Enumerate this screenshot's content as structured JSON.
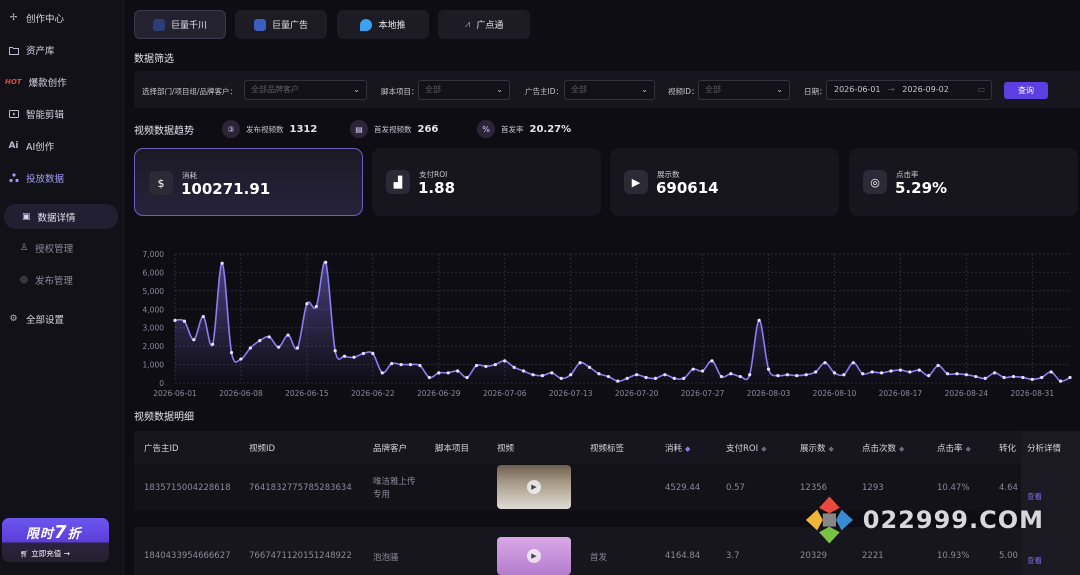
{
  "sidebar": {
    "items": [
      {
        "label": "创作中心",
        "icon": "cross-arrows-icon"
      },
      {
        "label": "资产库",
        "icon": "folder-icon"
      },
      {
        "label": "爆款创作",
        "icon": "hot-icon",
        "badge": "HOT"
      },
      {
        "label": "智能剪辑",
        "icon": "video-edit-icon"
      },
      {
        "label": "AI创作",
        "icon": "ai-icon",
        "badge": "Ai"
      },
      {
        "label": "投放数据",
        "icon": "nodes-icon"
      }
    ],
    "sub_items": [
      {
        "label": "数据详情",
        "icon": "chart-icon"
      },
      {
        "label": "授权管理",
        "icon": "user-icon"
      },
      {
        "label": "发布管理",
        "icon": "publish-icon"
      }
    ],
    "settings_label": "全部设置",
    "promo": {
      "title_a": "限时",
      "title_num": "7",
      "title_b": "折",
      "cta": "立即充值 →"
    }
  },
  "tabs": [
    {
      "label": "巨量千川",
      "icon_color": "#5b8cf5"
    },
    {
      "label": "巨量广告",
      "icon_color": "#4a7ff0"
    },
    {
      "label": "本地推",
      "icon_color": "#3ea0f0"
    },
    {
      "label": "广点通",
      "icon_color": "#5a6cf0"
    }
  ],
  "filters": {
    "section_title": "数据筛选",
    "dept_label": "选择部门/项目组/品牌客户：",
    "dept_placeholder": "全部品牌客户",
    "script_label": "脚本项目：",
    "script_placeholder": "全部",
    "advertiser_label": "广告主ID：",
    "advertiser_placeholder": "全部",
    "video_label": "视频ID：",
    "video_placeholder": "全部",
    "date_label": "日期：",
    "date_start": "2026-06-01",
    "date_sep": "→",
    "date_end": "2026-09-02",
    "query_button": "查询"
  },
  "trend": {
    "title": "视频数据趋势",
    "stats": [
      {
        "label": "发布视频数",
        "value": "1312",
        "icon": "video-count-icon"
      },
      {
        "label": "首发视频数",
        "value": "266",
        "icon": "first-video-icon"
      },
      {
        "label": "首发率",
        "value": "20.27%",
        "icon": "percent-icon"
      }
    ]
  },
  "kpis": [
    {
      "label": "消耗",
      "value": "100271.91",
      "icon": "spend-icon",
      "glyph": "$"
    },
    {
      "label": "支付ROI",
      "value": "1.88",
      "icon": "roi-icon",
      "glyph": "▟"
    },
    {
      "label": "展示数",
      "value": "690614",
      "icon": "display-icon",
      "glyph": "▶"
    },
    {
      "label": "点击率",
      "value": "5.29%",
      "icon": "click-rate-icon",
      "glyph": "◎"
    }
  ],
  "chart_data": {
    "type": "area",
    "title": "",
    "xlabel": "",
    "ylabel": "",
    "ylim": [
      0,
      7000
    ],
    "yticks": [
      "0",
      "1,000",
      "2,000",
      "3,000",
      "4,000",
      "5,000",
      "6,000",
      "7,000"
    ],
    "xticks": [
      "2026-06-01",
      "2026-06-08",
      "2026-06-15",
      "2026-06-22",
      "2026-06-29",
      "2026-07-06",
      "2026-07-13",
      "2026-07-20",
      "2026-07-27",
      "2026-08-03",
      "2026-08-10",
      "2026-08-17",
      "2026-08-24",
      "2026-08-31"
    ],
    "grid": true,
    "series": [
      {
        "color": "#8e7cf5",
        "values": [
          3400,
          3350,
          2350,
          3600,
          2100,
          6500,
          1650,
          1300,
          1900,
          2300,
          2500,
          1950,
          2600,
          1900,
          4300,
          4150,
          6550,
          1750,
          1450,
          1400,
          1600,
          1600,
          550,
          1050,
          1000,
          1000,
          950,
          300,
          550,
          550,
          650,
          300,
          950,
          900,
          1000,
          1200,
          850,
          650,
          450,
          400,
          550,
          250,
          450,
          1100,
          850,
          500,
          350,
          100,
          250,
          450,
          300,
          250,
          450,
          250,
          250,
          750,
          650,
          1200,
          350,
          500,
          350,
          450,
          3400,
          750,
          400,
          450,
          400,
          450,
          600,
          1100,
          550,
          450,
          1100,
          500,
          600,
          550,
          650,
          700,
          600,
          700,
          400,
          950,
          500,
          500,
          450,
          350,
          250,
          550,
          300,
          350,
          300,
          200,
          300,
          600,
          100,
          300
        ]
      }
    ]
  },
  "table": {
    "title": "视频数据明细",
    "columns": [
      "广告主ID",
      "视频ID",
      "品牌客户",
      "脚本项目",
      "视频",
      "视频标签",
      "消耗",
      "支付ROI",
      "展示数",
      "点击次数",
      "点击率",
      "转化",
      "分析详情"
    ],
    "rows": [
      {
        "advertiser": "1835715004228618",
        "video_id": "7641832775785283634",
        "brand": "唯洁雅上传专用",
        "script": "",
        "tag": "",
        "spend": "4529.44",
        "roi": "0.57",
        "display": "12356",
        "clicks": "1293",
        "ctr": "10.47%",
        "conv": "4.64",
        "action": "查看",
        "thumb_color": "#8a7a6a"
      },
      {
        "advertiser": "1840433954666627",
        "video_id": "7667471120151248922",
        "brand": "泡泡骚",
        "script": "",
        "tag": "首发",
        "spend": "4164.84",
        "roi": "3.7",
        "display": "20329",
        "clicks": "2221",
        "ctr": "10.93%",
        "conv": "5.00",
        "action": "查看",
        "thumb_color": "#c99ad6"
      }
    ]
  },
  "watermark": {
    "text": "022999.COM"
  }
}
